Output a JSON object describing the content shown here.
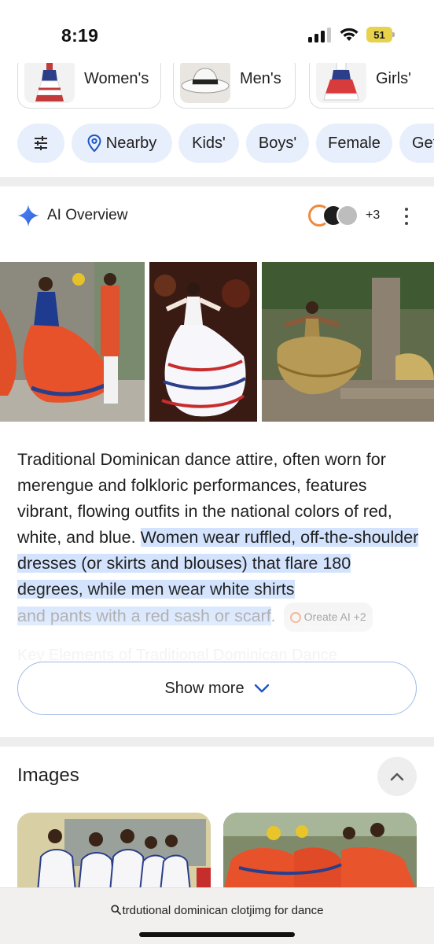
{
  "status_bar": {
    "time": "8:19",
    "battery": "51"
  },
  "categories": [
    {
      "label": "Women's"
    },
    {
      "label": "Men's"
    },
    {
      "label": "Girls'"
    }
  ],
  "chips": [
    {
      "label": "",
      "icon": "tune-icon"
    },
    {
      "label": "Nearby",
      "icon": "location-pin-icon"
    },
    {
      "label": "Kids'"
    },
    {
      "label": "Boys'"
    },
    {
      "label": "Female"
    },
    {
      "label": "Get"
    }
  ],
  "ai_overview": {
    "title": "AI Overview",
    "source_count": "+3",
    "text_plain": "Traditional Dominican dance attire, often worn for merengue and folkloric performances, features vibrant, flowing outfits in the national colors of red, white, and blue. ",
    "text_highlight": "Women wear ruffled, off-the-shoulder dresses (or skirts and blouses) that flare 180 degrees, while men wear white shirts",
    "text_faded": "and pants with a red sash or scarf",
    "text_period": ".",
    "source_chip": "Oreate AI +2",
    "hidden_heading": "Key Elements of Traditional Dominican Dance",
    "show_more": "Show more"
  },
  "images_section": {
    "title": "Images"
  },
  "search": {
    "query": "trdutional dominican clotjimg for dance"
  },
  "colors": {
    "chip_bg": "#e8effc",
    "highlight": "#d3e3fd",
    "accent_blue": "#1a56c4",
    "battery": "#e8d14b"
  }
}
